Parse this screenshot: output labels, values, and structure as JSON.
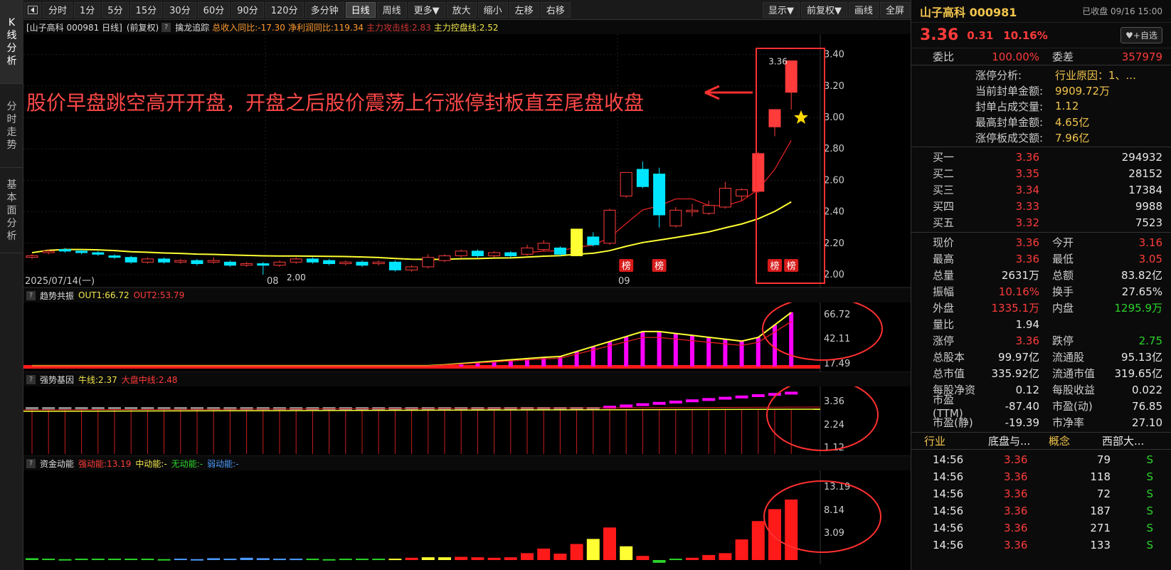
{
  "left_tabs": [
    {
      "label": "K线分析",
      "chars": [
        "K",
        "线",
        "分",
        "析"
      ]
    },
    {
      "label": "分时走势",
      "chars": [
        "分",
        "时",
        "走",
        "势"
      ]
    },
    {
      "label": "基本面分析",
      "chars": [
        "基",
        "本",
        "面",
        "分",
        "析"
      ]
    }
  ],
  "toolbar": {
    "back_icon": "back-arrow-icon",
    "periods": [
      "分时",
      "1分",
      "5分",
      "15分",
      "30分",
      "60分",
      "90分",
      "120分",
      "多分钟",
      "日线",
      "周线",
      "更多▼"
    ],
    "active_period": "日线",
    "zoom_in": "放大",
    "zoom_out": "缩小",
    "shift_left": "左移",
    "shift_right": "右移",
    "display": "显示▼",
    "adjust": "前复权▼",
    "draw": "画线",
    "fullscreen": "全屏"
  },
  "main_panel": {
    "title": "[山子高科 000981 日线]",
    "adjust_label": "(前复权)",
    "indicator_name": "擒龙追踪",
    "item1": "总收入同比:-17.30",
    "item2": "净利润同比:119.34",
    "item3": "主力攻击线:2.83",
    "item4": "主力控盘线:2.52",
    "y_ticks": [
      "3.40",
      "3.20",
      "3.00",
      "2.80",
      "2.60",
      "2.40",
      "2.20",
      "2.00"
    ],
    "x_labels": [
      "2025/07/14(一)",
      "08",
      "09"
    ],
    "price_label_high": "3.36",
    "price_label_low": "2.00",
    "bang_label": "榜",
    "annotation": "股价早盘跳空高开开盘，开盘之后股价震荡上行涨停封板直至尾盘收盘"
  },
  "panel2": {
    "name": "趋势共振",
    "out1": "OUT1:66.72",
    "out2": "OUT2:53.79",
    "y_ticks": [
      "66.72",
      "42.11",
      "17.49"
    ]
  },
  "panel3": {
    "name": "强势基因",
    "l1": "牛线:2.37",
    "l2": "大盘中线:2.48",
    "y_ticks": [
      "3.36",
      "2.24",
      "1.12"
    ]
  },
  "panel4": {
    "name": "资金动能",
    "l1": "强动能:13.19",
    "l2": "中动能:-",
    "l3": "无动能:-",
    "l4": "弱动能:-",
    "y_ticks": [
      "13.19",
      "8.14",
      "3.09"
    ]
  },
  "colors": {
    "up": "#ff3b3b",
    "down": "#00e5ff",
    "ma_yellow": "#ffff33",
    "ma_red": "#e02020",
    "magenta": "#ff00ff",
    "annot": "#ff4848"
  },
  "chart_data": [
    {
      "type": "candlestick",
      "title": "山子高科 000981 日线",
      "ylim": [
        2.0,
        3.4
      ],
      "candles": [
        [
          2.11,
          2.12,
          2.1,
          2.13
        ],
        [
          2.14,
          2.15,
          2.13,
          2.16
        ],
        [
          2.16,
          2.15,
          2.14,
          2.17
        ],
        [
          2.15,
          2.14,
          2.13,
          2.16
        ],
        [
          2.14,
          2.13,
          2.12,
          2.15
        ],
        [
          2.12,
          2.11,
          2.1,
          2.13
        ],
        [
          2.11,
          2.08,
          2.07,
          2.12
        ],
        [
          2.08,
          2.1,
          2.07,
          2.11
        ],
        [
          2.1,
          2.08,
          2.07,
          2.11
        ],
        [
          2.08,
          2.09,
          2.07,
          2.1
        ],
        [
          2.09,
          2.07,
          2.06,
          2.1
        ],
        [
          2.08,
          2.09,
          2.07,
          2.11
        ],
        [
          2.08,
          2.06,
          2.05,
          2.09
        ],
        [
          2.06,
          2.07,
          2.05,
          2.08
        ],
        [
          2.07,
          2.06,
          2.0,
          2.08
        ],
        [
          2.06,
          2.08,
          2.05,
          2.09
        ],
        [
          2.08,
          2.1,
          2.07,
          2.11
        ],
        [
          2.1,
          2.08,
          2.07,
          2.11
        ],
        [
          2.09,
          2.07,
          2.06,
          2.1
        ],
        [
          2.07,
          2.08,
          2.06,
          2.09
        ],
        [
          2.08,
          2.06,
          2.05,
          2.09
        ],
        [
          2.07,
          2.08,
          2.06,
          2.09
        ],
        [
          2.08,
          2.03,
          2.02,
          2.09
        ],
        [
          2.03,
          2.05,
          2.02,
          2.06
        ],
        [
          2.05,
          2.11,
          2.04,
          2.13
        ],
        [
          2.09,
          2.12,
          2.08,
          2.13
        ],
        [
          2.12,
          2.15,
          2.11,
          2.16
        ],
        [
          2.15,
          2.12,
          2.11,
          2.16
        ],
        [
          2.12,
          2.14,
          2.11,
          2.15
        ],
        [
          2.14,
          2.12,
          2.11,
          2.15
        ],
        [
          2.13,
          2.17,
          2.12,
          2.19
        ],
        [
          2.16,
          2.2,
          2.15,
          2.22
        ],
        [
          2.17,
          2.13,
          2.12,
          2.18
        ],
        [
          2.13,
          2.25,
          2.12,
          2.26
        ],
        [
          2.24,
          2.19,
          2.18,
          2.27
        ],
        [
          2.2,
          2.41,
          2.19,
          2.42
        ],
        [
          2.5,
          2.65,
          2.49,
          2.65
        ],
        [
          2.67,
          2.56,
          2.55,
          2.72
        ],
        [
          2.64,
          2.38,
          2.3,
          2.68
        ],
        [
          2.31,
          2.41,
          2.3,
          2.43
        ],
        [
          2.4,
          2.41,
          2.37,
          2.45
        ],
        [
          2.39,
          2.44,
          2.38,
          2.47
        ],
        [
          2.43,
          2.55,
          2.42,
          2.59
        ],
        [
          2.5,
          2.54,
          2.47,
          2.55
        ],
        [
          2.53,
          2.77,
          2.52,
          2.78
        ],
        [
          2.94,
          3.05,
          2.88,
          3.05
        ],
        [
          3.16,
          3.36,
          3.05,
          3.36
        ]
      ]
    },
    {
      "type": "bar",
      "title": "趋势共振",
      "ylim": [
        0,
        66.72
      ]
    },
    {
      "type": "bar",
      "title": "强势基因",
      "ylim": [
        0,
        3.36
      ]
    },
    {
      "type": "bar",
      "title": "资金动能",
      "ylim": [
        0,
        13.19
      ]
    }
  ],
  "right_panel": {
    "stock_title": "山子高科 000981",
    "status": "已收盘 09/16 15:00",
    "price": "3.36",
    "change": "0.31",
    "change_pct": "10.16%",
    "fav_button": "♥+自选",
    "webi_label": "委比",
    "webi_value": "100.00%",
    "weicha_label": "委差",
    "weicha_value": "357979",
    "limitup": [
      {
        "k": "涨停分析:",
        "v": "行业原因：1、..."
      },
      {
        "k": "当前封单金额:",
        "v": "9909.72万"
      },
      {
        "k": "封单占成交量:",
        "v": "1.12"
      },
      {
        "k": "最高封单金额:",
        "v": "4.65亿"
      },
      {
        "k": "涨停板成交额:",
        "v": "7.96亿"
      }
    ],
    "buy_levels": [
      {
        "k": "买一",
        "p": "3.36",
        "v": "294932"
      },
      {
        "k": "买二",
        "p": "3.35",
        "v": "28152"
      },
      {
        "k": "买三",
        "p": "3.34",
        "v": "17384"
      },
      {
        "k": "买四",
        "p": "3.33",
        "v": "9988"
      },
      {
        "k": "买五",
        "p": "3.32",
        "v": "7523"
      }
    ],
    "stats": [
      {
        "k": "现价",
        "v": "3.36",
        "vc": "red",
        "k2": "今开",
        "v2": "3.16",
        "v2c": "red"
      },
      {
        "k": "最高",
        "v": "3.36",
        "vc": "red",
        "k2": "最低",
        "v2": "3.05",
        "v2c": "red"
      },
      {
        "k": "总量",
        "v": "2631万",
        "vc": "white",
        "k2": "总额",
        "v2": "83.82亿",
        "v2c": "white"
      },
      {
        "k": "振幅",
        "v": "10.16%",
        "vc": "red",
        "k2": "换手",
        "v2": "27.65%",
        "v2c": "white"
      },
      {
        "k": "外盘",
        "v": "1335.1万",
        "vc": "red",
        "k2": "内盘",
        "v2": "1295.9万",
        "v2c": "green"
      },
      {
        "k": "量比",
        "v": "1.94",
        "vc": "white",
        "k2": "",
        "v2": "",
        "v2c": "white"
      },
      {
        "k": "涨停",
        "v": "3.36",
        "vc": "red",
        "k2": "跌停",
        "v2": "2.75",
        "v2c": "green"
      },
      {
        "k": "总股本",
        "v": "99.97亿",
        "vc": "white",
        "k2": "流通股",
        "v2": "95.13亿",
        "v2c": "white"
      },
      {
        "k": "总市值",
        "v": "335.92亿",
        "vc": "white",
        "k2": "流通市值",
        "v2": "319.65亿",
        "v2c": "white"
      },
      {
        "k": "每股净资",
        "v": "0.12",
        "vc": "white",
        "k2": "每股收益",
        "v2": "0.022",
        "v2c": "white"
      },
      {
        "k": "市盈(TTM)",
        "v": "-87.40",
        "vc": "white",
        "k2": "市盈(动)",
        "v2": "76.85",
        "v2c": "white"
      },
      {
        "k": "市盈(静)",
        "v": "-19.39",
        "vc": "white",
        "k2": "市净率",
        "v2": "27.10",
        "v2c": "white"
      }
    ],
    "industry_label": "行业",
    "industry_value": "底盘与...",
    "concept_label": "概念",
    "concept_value": "西部大...",
    "ticks": [
      {
        "t": "14:56",
        "p": "3.36",
        "v": "79",
        "s": "S"
      },
      {
        "t": "14:56",
        "p": "3.36",
        "v": "118",
        "s": "S"
      },
      {
        "t": "14:56",
        "p": "3.36",
        "v": "72",
        "s": "S"
      },
      {
        "t": "14:56",
        "p": "3.36",
        "v": "187",
        "s": "S"
      },
      {
        "t": "14:56",
        "p": "3.36",
        "v": "271",
        "s": "S"
      },
      {
        "t": "14:56",
        "p": "3.36",
        "v": "133",
        "s": "S"
      }
    ]
  }
}
